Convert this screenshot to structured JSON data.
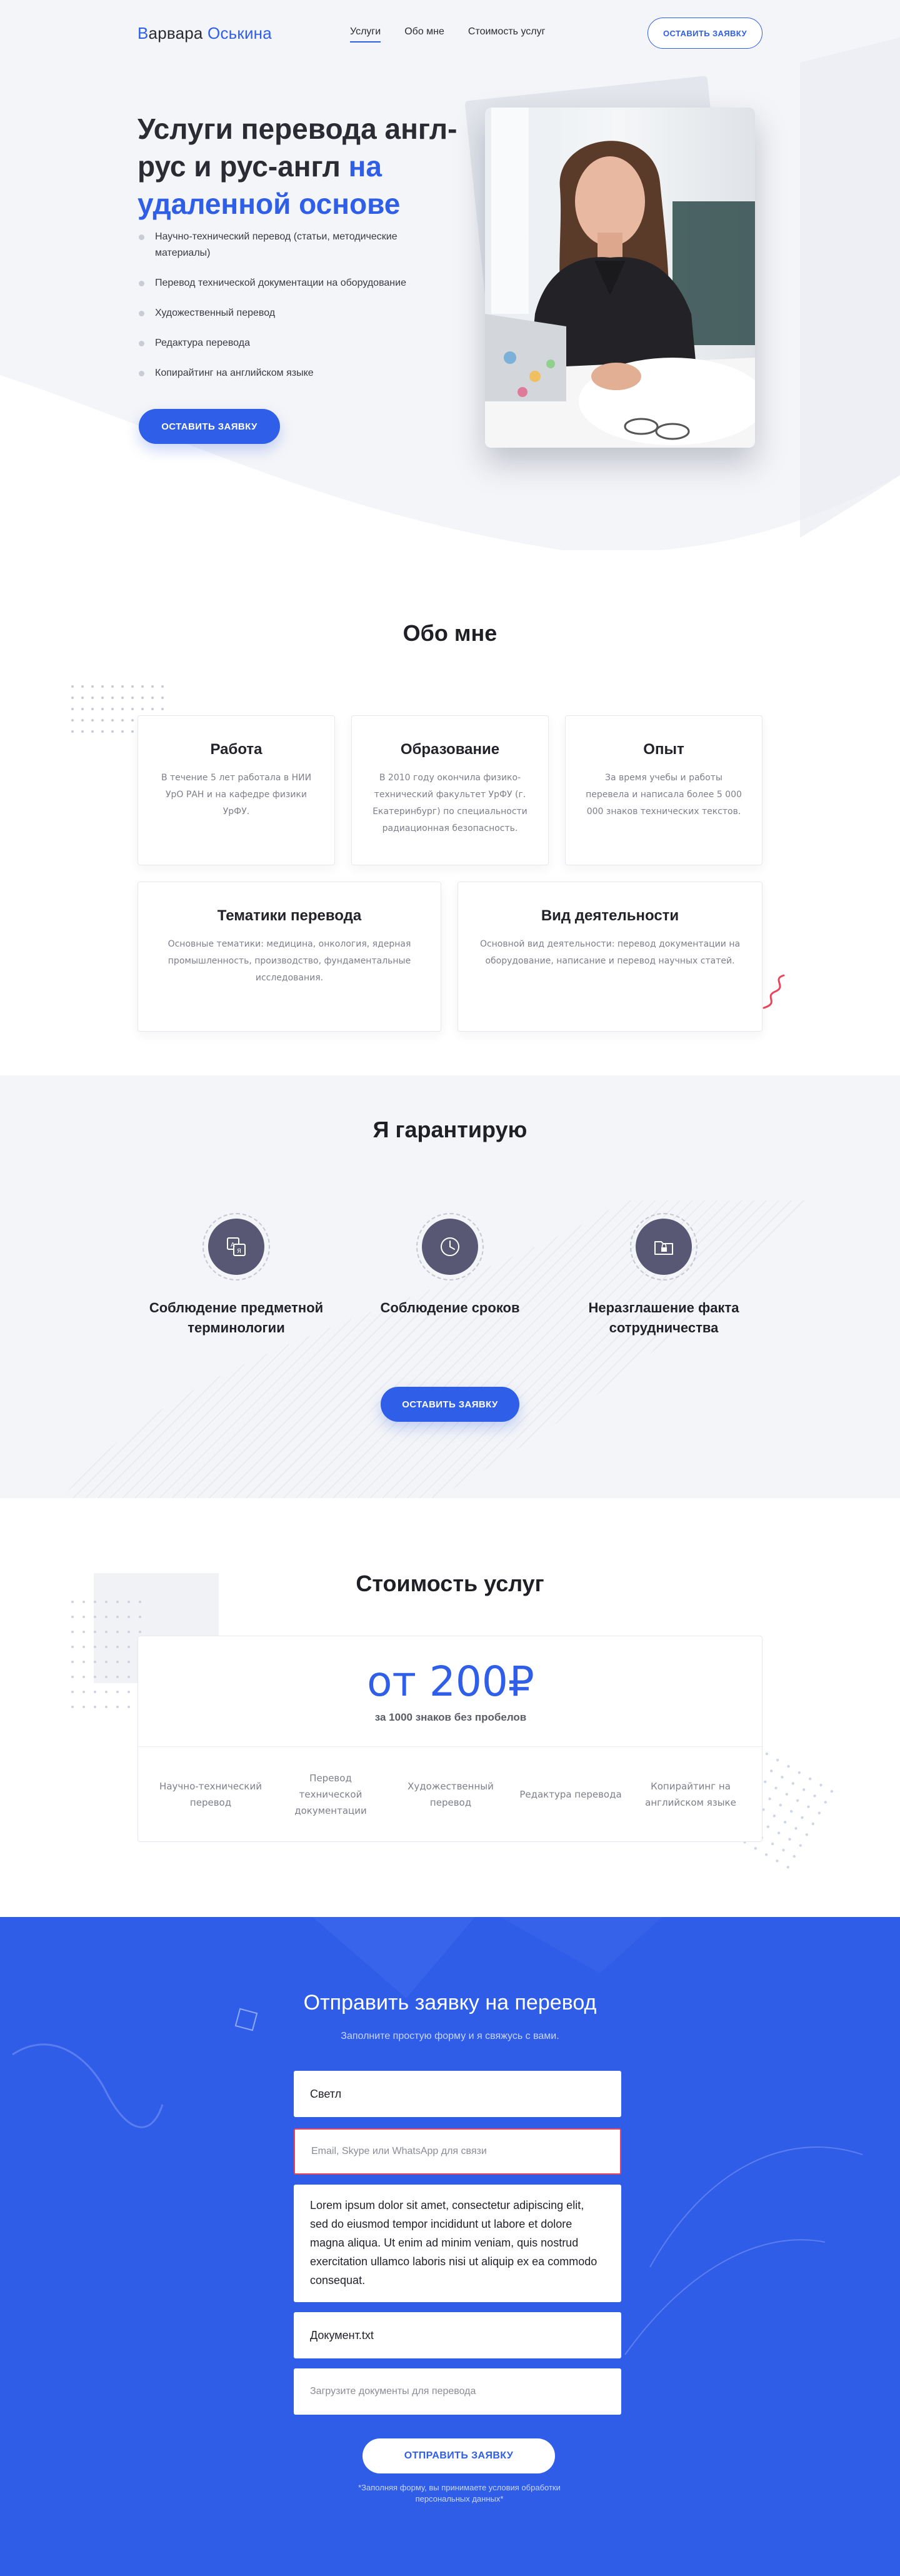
{
  "header": {
    "logo_first": "В",
    "logo_rest": "арвара",
    "logo_accent": "Оськина",
    "nav": [
      {
        "label": "Услуги",
        "active": true
      },
      {
        "label": "Обо мне",
        "active": false
      },
      {
        "label": "Стоимость услуг",
        "active": false
      }
    ],
    "cta_label": "ОСТАВИТЬ ЗАЯВКУ"
  },
  "hero": {
    "title_dark": "Услуги перевода англ-рус и рус-англ",
    "title_blue": "на удаленной основе",
    "services": [
      "Научно-технический перевод (статьи, методические материалы)",
      "Перевод технической документации на оборудование",
      "Художественный перевод",
      "Редактура перевода",
      "Копирайтинг на английском языке"
    ],
    "cta_label": "ОСТАВИТЬ ЗАЯВКУ"
  },
  "about": {
    "title": "Обо мне",
    "cards": [
      {
        "title": "Работа",
        "text": "В течение 5 лет работала в НИИ УрО РАН и на кафедре физики УрФУ."
      },
      {
        "title": "Образование",
        "text": "В 2010 году окончила физико-технический факультет УрФУ (г. Екатеринбург) по специальности радиационная безопасность."
      },
      {
        "title": "Опыт",
        "text": "За время учебы и работы перевела и написала более 5 000 000 знаков технических текстов."
      },
      {
        "title": "Тематики перевода",
        "text": "Основные тематики: медицина, онкология, ядерная промышленность, производство, фундаментальные исследования."
      },
      {
        "title": "Вид деятельности",
        "text": "Основной вид деятельности: перевод документации на оборудование, написание и перевод научных статей."
      }
    ]
  },
  "guarantee": {
    "title": "Я гарантирую",
    "items": [
      {
        "label": "Соблюдение предметной терминологии",
        "icon": "translate-icon"
      },
      {
        "label": "Соблюдение сроков",
        "icon": "clock-icon"
      },
      {
        "label": "Неразглашение факта сотрудничества",
        "icon": "lock-folder-icon"
      }
    ],
    "cta_label": "ОСТАВИТЬ ЗАЯВКУ"
  },
  "price": {
    "title": "Стоимость услуг",
    "amount": "от 200₽",
    "unit": "за 1000 знаков без пробелов",
    "items": [
      "Научно-технический перевод",
      "Перевод технической документации",
      "Художественный перевод",
      "Редактура перевода",
      "Копирайтинг на английском языке"
    ]
  },
  "form": {
    "title": "Отправить заявку на перевод",
    "subtitle": "Заполните простую форму и я свяжусь с вами.",
    "name_value": "Светл",
    "contact_placeholder": "Email, Skype или WhatsApp для связи",
    "message_value": "Lorem ipsum dolor sit amet, consectetur adipiscing elit, sed do eiusmod tempor incididunt ut labore et dolore magna aliqua. Ut enim ad minim veniam, quis nostrud exercitation ullamco laboris nisi ut aliquip ex ea commodo consequat.",
    "file_value": "Документ.txt",
    "upload_placeholder": "Загрузите документы для перевода",
    "submit_label": "ОТПРАВИТЬ ЗАЯВКУ",
    "note": "*Заполняя форму, вы принимаете условия обработки персональных данных*"
  },
  "colors": {
    "accent": "#2f5ee8",
    "form_bg": "#2f5de8",
    "icon_circle": "#585874",
    "error_border": "#e8455b"
  }
}
